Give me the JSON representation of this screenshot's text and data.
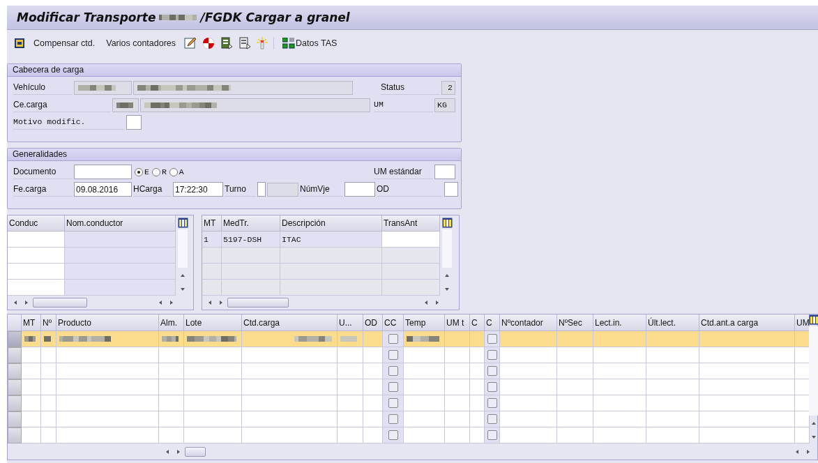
{
  "window": {
    "title_start": "Modificar Transporte",
    "title_end": "/FGDK Cargar a granel"
  },
  "toolbar": {
    "buttons": [
      {
        "label": "Compensar ctd."
      },
      {
        "label": "Varios contadores"
      }
    ],
    "data_button": {
      "label": "Datos TAS"
    }
  },
  "header_panel": {
    "title": "Cabecera de carga",
    "vehicle": {
      "label": "Vehículo"
    },
    "center": {
      "label": "Ce.carga"
    },
    "status": {
      "label": "Status",
      "value": "2"
    },
    "unit": {
      "label": "UM",
      "value": "KG"
    },
    "reason": {
      "label": "Motivo modific."
    }
  },
  "general_panel": {
    "title": "Generalidades",
    "document": {
      "label": "Documento"
    },
    "modes": [
      {
        "label": "E",
        "selected": true
      },
      {
        "label": "R",
        "selected": false
      },
      {
        "label": "A",
        "selected": false
      }
    ],
    "std_unit": {
      "label": "UM estándar"
    },
    "load_date": {
      "label": "Fe.carga",
      "value": "09.08.2016"
    },
    "load_time": {
      "label": "HCarga",
      "value": "17:22:30"
    },
    "shift": {
      "label": "Turno"
    },
    "trip": {
      "label": "NúmVje"
    },
    "od": {
      "label": "OD"
    }
  },
  "drivers_table": {
    "columns": [
      "Conduc",
      "Nom.conductor"
    ]
  },
  "vehicles_table": {
    "columns": [
      "MT",
      "MedTr.",
      "Descripción",
      "TransAnt"
    ],
    "rows": [
      {
        "cells": [
          "1",
          "5197-DSH",
          "ITAC"
        ]
      }
    ]
  },
  "items_table": {
    "columns": [
      "MT",
      "Nº",
      "Producto",
      "Alm.",
      "Lote",
      "Ctd.carga",
      "U...",
      "OD",
      "CC",
      "Temp",
      "UM t",
      "C",
      "C",
      "Nºcontador",
      "NºSec",
      "Lect.in.",
      "Últ.lect.",
      "Ctd.ant.a carga",
      "UM"
    ],
    "rows": [
      {
        "selected": true,
        "cells": [
          {
            "kind": "blurred"
          },
          {
            "kind": "blurred"
          },
          {
            "kind": "blurred"
          },
          {
            "kind": "blurred"
          },
          {
            "kind": "blurred"
          },
          {
            "kind": "blurred"
          },
          {
            "kind": "blurred"
          },
          {
            "kind": "blank"
          },
          {
            "kind": "checkbox",
            "checked": false
          },
          {
            "kind": "blurred"
          },
          {
            "kind": "blank"
          },
          {
            "kind": "blank"
          },
          {
            "kind": "checkbox",
            "checked": false
          },
          {
            "kind": "blank"
          },
          {
            "kind": "blank"
          },
          {
            "kind": "blank"
          },
          {
            "kind": "blank"
          },
          {
            "kind": "blank"
          },
          {
            "kind": "blank"
          }
        ]
      },
      {
        "selected": false,
        "cells": [
          {
            "kind": "blank"
          },
          {
            "kind": "blank"
          },
          {
            "kind": "blank"
          },
          {
            "kind": "blank"
          },
          {
            "kind": "blank"
          },
          {
            "kind": "blank"
          },
          {
            "kind": "blank"
          },
          {
            "kind": "blank"
          },
          {
            "kind": "checkbox",
            "checked": false
          },
          {
            "kind": "blank"
          },
          {
            "kind": "blank"
          },
          {
            "kind": "blank"
          },
          {
            "kind": "checkbox",
            "checked": false
          },
          {
            "kind": "blank"
          },
          {
            "kind": "blank"
          },
          {
            "kind": "blank"
          },
          {
            "kind": "blank"
          },
          {
            "kind": "blank"
          },
          {
            "kind": "blank"
          }
        ]
      },
      {
        "selected": false,
        "cells": [
          {
            "kind": "blank"
          },
          {
            "kind": "blank"
          },
          {
            "kind": "blank"
          },
          {
            "kind": "blank"
          },
          {
            "kind": "blank"
          },
          {
            "kind": "blank"
          },
          {
            "kind": "blank"
          },
          {
            "kind": "blank"
          },
          {
            "kind": "checkbox",
            "checked": false
          },
          {
            "kind": "blank"
          },
          {
            "kind": "blank"
          },
          {
            "kind": "blank"
          },
          {
            "kind": "checkbox",
            "checked": false
          },
          {
            "kind": "blank"
          },
          {
            "kind": "blank"
          },
          {
            "kind": "blank"
          },
          {
            "kind": "blank"
          },
          {
            "kind": "blank"
          },
          {
            "kind": "blank"
          }
        ]
      },
      {
        "selected": false,
        "cells": [
          {
            "kind": "blank"
          },
          {
            "kind": "blank"
          },
          {
            "kind": "blank"
          },
          {
            "kind": "blank"
          },
          {
            "kind": "blank"
          },
          {
            "kind": "blank"
          },
          {
            "kind": "blank"
          },
          {
            "kind": "blank"
          },
          {
            "kind": "checkbox",
            "checked": false
          },
          {
            "kind": "blank"
          },
          {
            "kind": "blank"
          },
          {
            "kind": "blank"
          },
          {
            "kind": "checkbox",
            "checked": false
          },
          {
            "kind": "blank"
          },
          {
            "kind": "blank"
          },
          {
            "kind": "blank"
          },
          {
            "kind": "blank"
          },
          {
            "kind": "blank"
          },
          {
            "kind": "blank"
          }
        ]
      },
      {
        "selected": false,
        "cells": [
          {
            "kind": "blank"
          },
          {
            "kind": "blank"
          },
          {
            "kind": "blank"
          },
          {
            "kind": "blank"
          },
          {
            "kind": "blank"
          },
          {
            "kind": "blank"
          },
          {
            "kind": "blank"
          },
          {
            "kind": "blank"
          },
          {
            "kind": "checkbox",
            "checked": false
          },
          {
            "kind": "blank"
          },
          {
            "kind": "blank"
          },
          {
            "kind": "blank"
          },
          {
            "kind": "checkbox",
            "checked": false
          },
          {
            "kind": "blank"
          },
          {
            "kind": "blank"
          },
          {
            "kind": "blank"
          },
          {
            "kind": "blank"
          },
          {
            "kind": "blank"
          },
          {
            "kind": "blank"
          }
        ]
      },
      {
        "selected": false,
        "cells": [
          {
            "kind": "blank"
          },
          {
            "kind": "blank"
          },
          {
            "kind": "blank"
          },
          {
            "kind": "blank"
          },
          {
            "kind": "blank"
          },
          {
            "kind": "blank"
          },
          {
            "kind": "blank"
          },
          {
            "kind": "blank"
          },
          {
            "kind": "checkbox",
            "checked": false
          },
          {
            "kind": "blank"
          },
          {
            "kind": "blank"
          },
          {
            "kind": "blank"
          },
          {
            "kind": "checkbox",
            "checked": false
          },
          {
            "kind": "blank"
          },
          {
            "kind": "blank"
          },
          {
            "kind": "blank"
          },
          {
            "kind": "blank"
          },
          {
            "kind": "blank"
          },
          {
            "kind": "blank"
          }
        ]
      },
      {
        "selected": false,
        "cells": [
          {
            "kind": "blank"
          },
          {
            "kind": "blank"
          },
          {
            "kind": "blank"
          },
          {
            "kind": "blank"
          },
          {
            "kind": "blank"
          },
          {
            "kind": "blank"
          },
          {
            "kind": "blank"
          },
          {
            "kind": "blank"
          },
          {
            "kind": "checkbox",
            "checked": false
          },
          {
            "kind": "blank"
          },
          {
            "kind": "blank"
          },
          {
            "kind": "blank"
          },
          {
            "kind": "checkbox",
            "checked": false
          },
          {
            "kind": "blank"
          },
          {
            "kind": "blank"
          },
          {
            "kind": "blank"
          },
          {
            "kind": "blank"
          },
          {
            "kind": "blank"
          },
          {
            "kind": "blank"
          }
        ]
      }
    ]
  }
}
